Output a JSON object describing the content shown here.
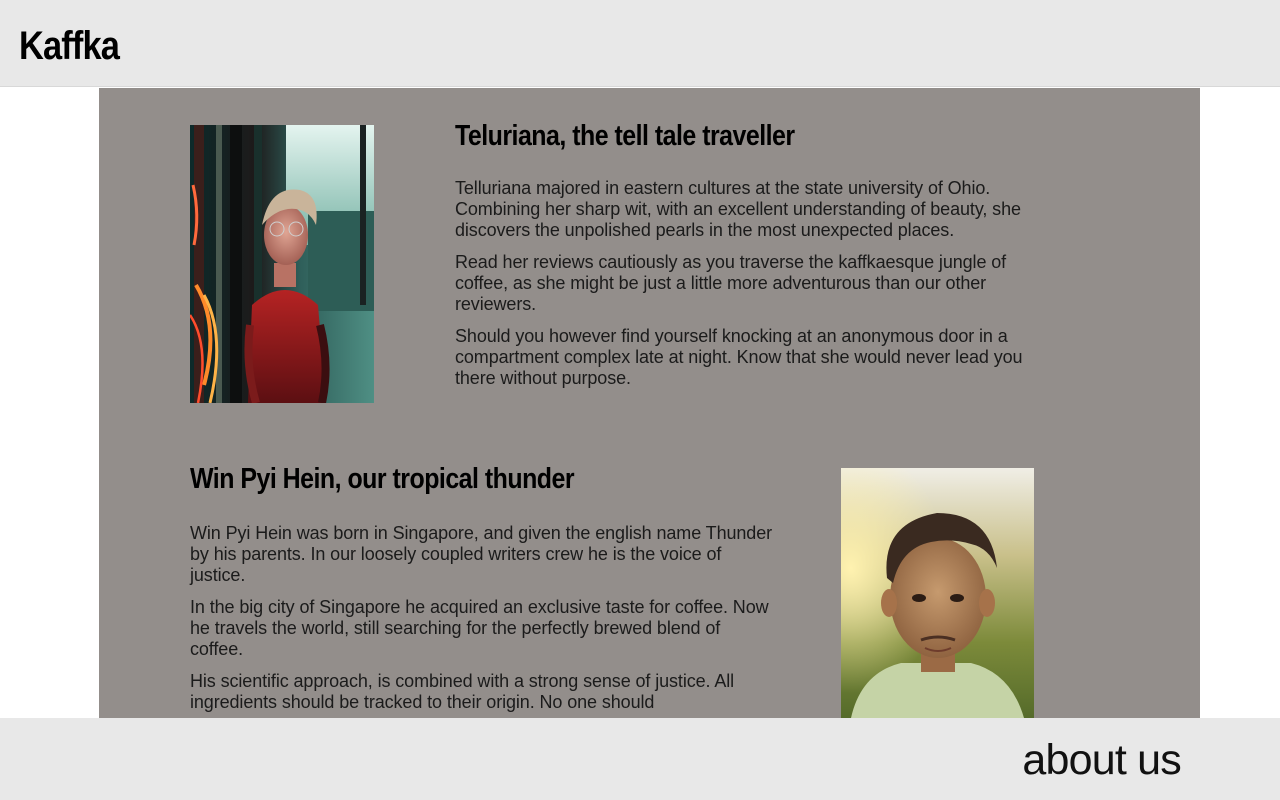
{
  "header": {
    "logo": "Kaffka"
  },
  "profiles": [
    {
      "name_title": "Teluriana, the tell tale traveller",
      "paragraphs": [
        "Telluriana majored in eastern cultures at the state university of Ohio. Combining her sharp wit, with an excellent understanding of beauty, she discovers the unpolished pearls in the most unexpected places.",
        "Read her reviews cautiously as you traverse the kaffkaesque jungle of coffee, as she might be just a little more adventurous than our other reviewers.",
        "Should you however find yourself knocking at an anonymous door in a compartment complex late at night. Know that she would never lead you there without purpose."
      ]
    },
    {
      "name_title": "Win Pyi Hein, our tropical thunder",
      "paragraphs": [
        "Win Pyi Hein was born in Singapore, and given the english name Thunder by his parents. In our loosely coupled writers crew he is the voice of justice.",
        "In the big city of Singapore he acquired an exclusive taste for coffee. Now he travels the world, still searching for the perfectly brewed blend of coffee.",
        "His scientific approach, is combined with a strong sense of justice. All ingredients should be tracked to their origin. No one should"
      ]
    }
  ],
  "footer": {
    "label": "about us"
  }
}
